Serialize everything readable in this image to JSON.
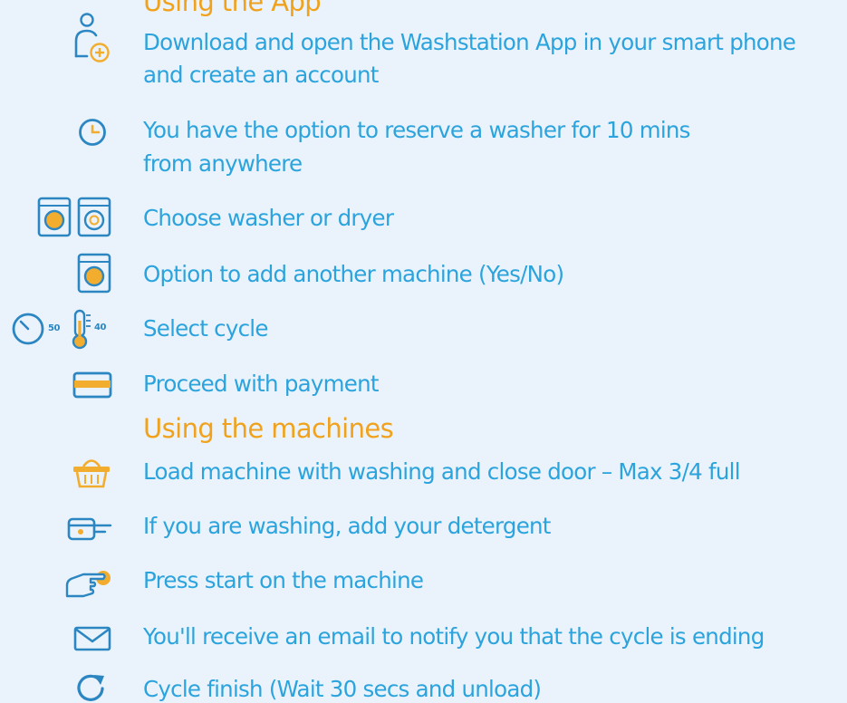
{
  "sections": {
    "app": {
      "heading": "Using the App",
      "steps": [
        {
          "icon": "user-add-icon",
          "lines": [
            "Download and open the Washstation App in your smart phone",
            "and create an account"
          ]
        },
        {
          "icon": "clock-icon",
          "lines": [
            "You have the option to reserve a washer for 10 mins",
            "from anywhere"
          ]
        },
        {
          "icon": "washer-dryer-icon",
          "lines": [
            "Choose washer or dryer"
          ]
        },
        {
          "icon": "washer-icon",
          "lines": [
            "Option to add another machine (Yes/No)"
          ]
        },
        {
          "icon": "cycle-timer-temperature-icon",
          "lines": [
            "Select cycle"
          ],
          "icon_labels": {
            "timer": "50",
            "temperature": "40"
          }
        },
        {
          "icon": "credit-card-icon",
          "lines": [
            "Proceed with payment"
          ]
        }
      ]
    },
    "machines": {
      "heading": "Using the machines",
      "steps": [
        {
          "icon": "laundry-basket-icon",
          "lines": [
            "Load machine with washing and close door – Max 3/4 full"
          ]
        },
        {
          "icon": "detergent-drawer-icon",
          "lines": [
            "If you are washing, add your detergent"
          ]
        },
        {
          "icon": "press-button-icon",
          "lines": [
            "Press start on the machine"
          ]
        },
        {
          "icon": "email-icon",
          "lines": [
            "You'll receive an email to notify you that the cycle is ending"
          ]
        },
        {
          "icon": "refresh-icon",
          "lines": [
            "Cycle finish (Wait 30 secs and unload)"
          ]
        }
      ]
    }
  },
  "colors": {
    "background": "#eaf3fb",
    "heading": "#f0a21c",
    "text": "#2ba3dd",
    "icon": "#2b86c2",
    "accent": "#f3ad2e"
  }
}
